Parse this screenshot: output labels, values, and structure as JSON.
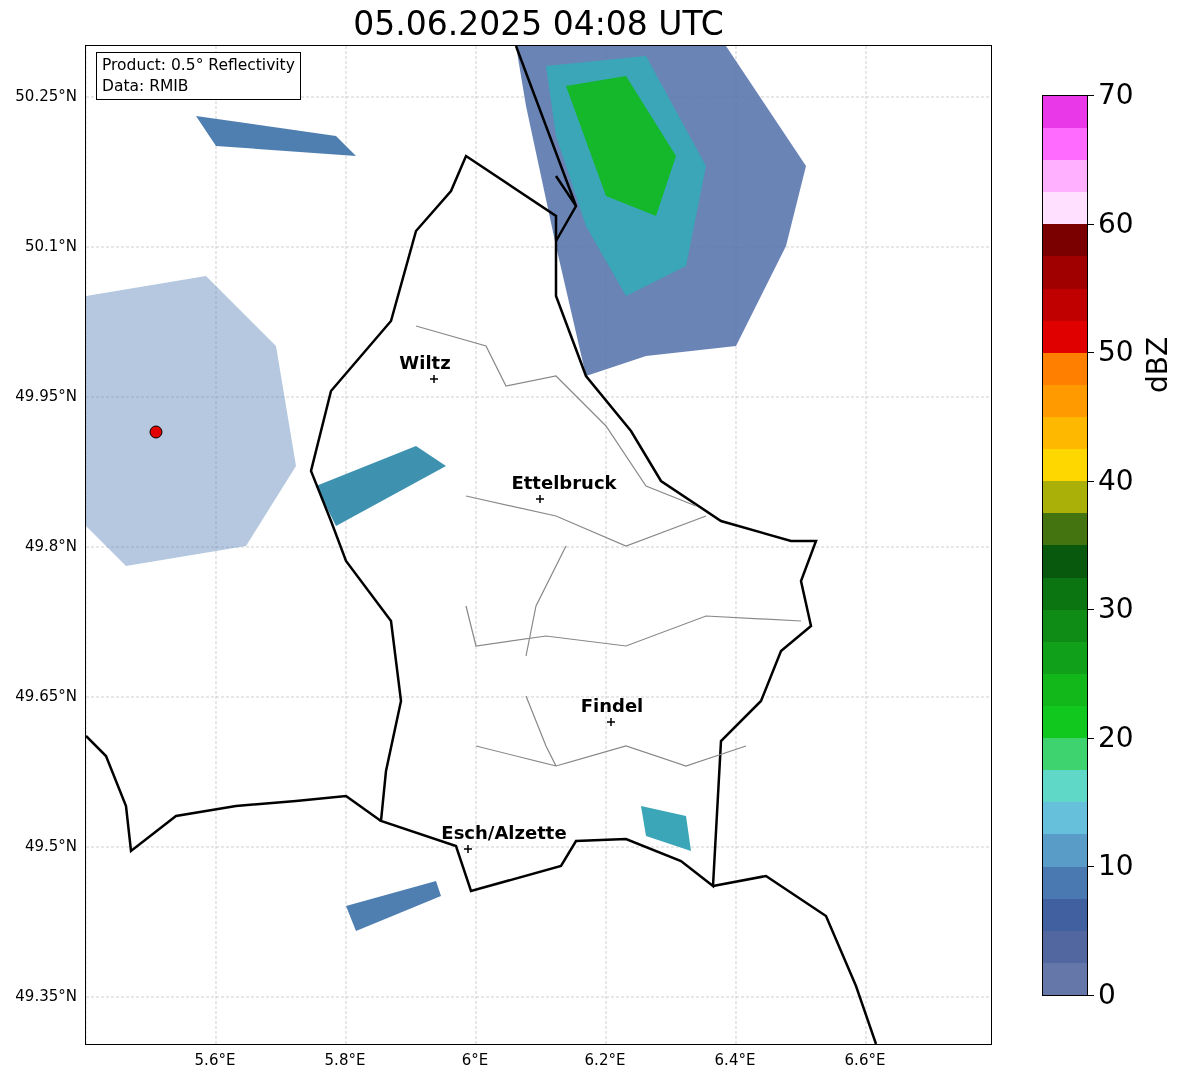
{
  "title": "05.06.2025 04:08 UTC",
  "info_box": {
    "lines": [
      "Product: 0.5° Reflectivity",
      "Data: RMIB"
    ]
  },
  "map": {
    "lat_labels": [
      "50.25°N",
      "50.1°N",
      "49.95°N",
      "49.8°N",
      "49.65°N",
      "49.5°N",
      "49.35°N"
    ],
    "lon_labels": [
      "5.6°E",
      "5.8°E",
      "6°E",
      "6.2°E",
      "6.4°E",
      "6.6°E"
    ],
    "cities": [
      {
        "name": "Wiltz"
      },
      {
        "name": "Ettelbruck"
      },
      {
        "name": "Findel"
      },
      {
        "name": "Esch/Alzette"
      }
    ]
  },
  "colorbar": {
    "label": "dBZ",
    "ticks": [
      "70",
      "60",
      "50",
      "40",
      "30",
      "20",
      "10",
      "0"
    ],
    "segments": [
      {
        "color": "#6577a8"
      },
      {
        "color": "#52669f"
      },
      {
        "color": "#4060a0"
      },
      {
        "color": "#4a78b0"
      },
      {
        "color": "#5a9cc8"
      },
      {
        "color": "#66c0dc"
      },
      {
        "color": "#5fd8c8"
      },
      {
        "color": "#3ed36e"
      },
      {
        "color": "#10c81e"
      },
      {
        "color": "#12b81a"
      },
      {
        "color": "#11a01a"
      },
      {
        "color": "#0f8c16"
      },
      {
        "color": "#0b7512"
      },
      {
        "color": "#08580e"
      },
      {
        "color": "#447410"
      },
      {
        "color": "#aab008"
      },
      {
        "color": "#ffd700"
      },
      {
        "color": "#ffb800"
      },
      {
        "color": "#ff9a00"
      },
      {
        "color": "#ff7f00"
      },
      {
        "color": "#e00000"
      },
      {
        "color": "#c00000"
      },
      {
        "color": "#a00000"
      },
      {
        "color": "#7a0000"
      },
      {
        "color": "#ffe0ff"
      },
      {
        "color": "#ffb0ff"
      },
      {
        "color": "#ff6aff"
      },
      {
        "color": "#e838e8"
      }
    ]
  }
}
